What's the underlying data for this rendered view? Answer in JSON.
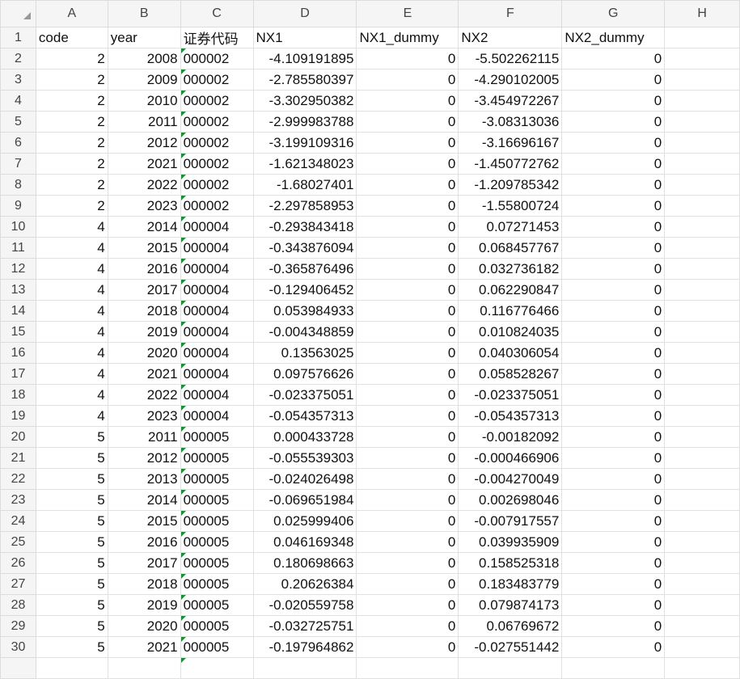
{
  "columns": [
    "A",
    "B",
    "C",
    "D",
    "E",
    "F",
    "G",
    "H"
  ],
  "header_row": [
    "code",
    "year",
    "证券代码",
    "NX1",
    "NX1_dummy",
    "NX2",
    "NX2_dummy",
    ""
  ],
  "rows": [
    [
      "2",
      "2008",
      "000002",
      "-4.109191895",
      "0",
      "-5.502262115",
      "0"
    ],
    [
      "2",
      "2009",
      "000002",
      "-2.785580397",
      "0",
      "-4.290102005",
      "0"
    ],
    [
      "2",
      "2010",
      "000002",
      "-3.302950382",
      "0",
      "-3.454972267",
      "0"
    ],
    [
      "2",
      "2011",
      "000002",
      "-2.999983788",
      "0",
      "-3.08313036",
      "0"
    ],
    [
      "2",
      "2012",
      "000002",
      "-3.199109316",
      "0",
      "-3.16696167",
      "0"
    ],
    [
      "2",
      "2021",
      "000002",
      "-1.621348023",
      "0",
      "-1.450772762",
      "0"
    ],
    [
      "2",
      "2022",
      "000002",
      "-1.68027401",
      "0",
      "-1.209785342",
      "0"
    ],
    [
      "2",
      "2023",
      "000002",
      "-2.297858953",
      "0",
      "-1.55800724",
      "0"
    ],
    [
      "4",
      "2014",
      "000004",
      "-0.293843418",
      "0",
      "0.07271453",
      "0"
    ],
    [
      "4",
      "2015",
      "000004",
      "-0.343876094",
      "0",
      "0.068457767",
      "0"
    ],
    [
      "4",
      "2016",
      "000004",
      "-0.365876496",
      "0",
      "0.032736182",
      "0"
    ],
    [
      "4",
      "2017",
      "000004",
      "-0.129406452",
      "0",
      "0.062290847",
      "0"
    ],
    [
      "4",
      "2018",
      "000004",
      "0.053984933",
      "0",
      "0.116776466",
      "0"
    ],
    [
      "4",
      "2019",
      "000004",
      "-0.004348859",
      "0",
      "0.010824035",
      "0"
    ],
    [
      "4",
      "2020",
      "000004",
      "0.13563025",
      "0",
      "0.040306054",
      "0"
    ],
    [
      "4",
      "2021",
      "000004",
      "0.097576626",
      "0",
      "0.058528267",
      "0"
    ],
    [
      "4",
      "2022",
      "000004",
      "-0.023375051",
      "0",
      "-0.023375051",
      "0"
    ],
    [
      "4",
      "2023",
      "000004",
      "-0.054357313",
      "0",
      "-0.054357313",
      "0"
    ],
    [
      "5",
      "2011",
      "000005",
      "0.000433728",
      "0",
      "-0.00182092",
      "0"
    ],
    [
      "5",
      "2012",
      "000005",
      "-0.055539303",
      "0",
      "-0.000466906",
      "0"
    ],
    [
      "5",
      "2013",
      "000005",
      "-0.024026498",
      "0",
      "-0.004270049",
      "0"
    ],
    [
      "5",
      "2014",
      "000005",
      "-0.069651984",
      "0",
      "0.002698046",
      "0"
    ],
    [
      "5",
      "2015",
      "000005",
      "0.025999406",
      "0",
      "-0.007917557",
      "0"
    ],
    [
      "5",
      "2016",
      "000005",
      "0.046169348",
      "0",
      "0.039935909",
      "0"
    ],
    [
      "5",
      "2017",
      "000005",
      "0.180698663",
      "0",
      "0.158525318",
      "0"
    ],
    [
      "5",
      "2018",
      "000005",
      "0.20626384",
      "0",
      "0.183483779",
      "0"
    ],
    [
      "5",
      "2019",
      "000005",
      "-0.020559758",
      "0",
      "0.079874173",
      "0"
    ],
    [
      "5",
      "2020",
      "000005",
      "-0.032725751",
      "0",
      "0.06769672",
      "0"
    ],
    [
      "5",
      "2021",
      "000005",
      "-0.197964862",
      "0",
      "-0.027551442",
      "0"
    ]
  ],
  "colors": {
    "header_bg": "#f5f5f5",
    "grid": "#e1e1e1",
    "flag": "#1e8c3a"
  }
}
